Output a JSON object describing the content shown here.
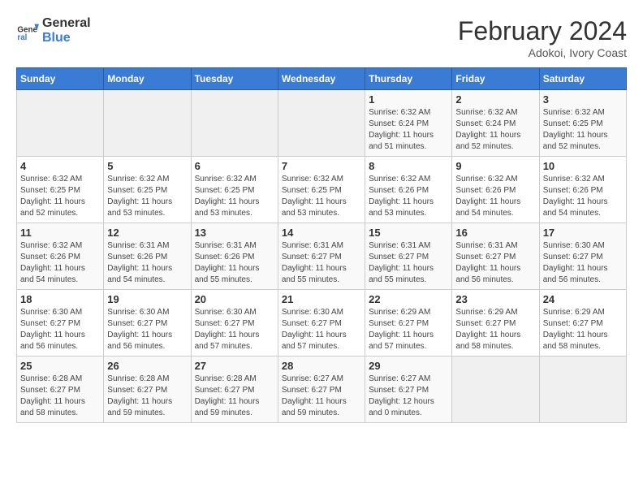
{
  "header": {
    "logo_general": "General",
    "logo_blue": "Blue",
    "title": "February 2024",
    "subtitle": "Adokoi, Ivory Coast"
  },
  "days_of_week": [
    "Sunday",
    "Monday",
    "Tuesday",
    "Wednesday",
    "Thursday",
    "Friday",
    "Saturday"
  ],
  "weeks": [
    [
      {
        "day": "",
        "info": ""
      },
      {
        "day": "",
        "info": ""
      },
      {
        "day": "",
        "info": ""
      },
      {
        "day": "",
        "info": ""
      },
      {
        "day": "1",
        "info": "Sunrise: 6:32 AM\nSunset: 6:24 PM\nDaylight: 11 hours and 51 minutes."
      },
      {
        "day": "2",
        "info": "Sunrise: 6:32 AM\nSunset: 6:24 PM\nDaylight: 11 hours and 52 minutes."
      },
      {
        "day": "3",
        "info": "Sunrise: 6:32 AM\nSunset: 6:25 PM\nDaylight: 11 hours and 52 minutes."
      }
    ],
    [
      {
        "day": "4",
        "info": "Sunrise: 6:32 AM\nSunset: 6:25 PM\nDaylight: 11 hours and 52 minutes."
      },
      {
        "day": "5",
        "info": "Sunrise: 6:32 AM\nSunset: 6:25 PM\nDaylight: 11 hours and 53 minutes."
      },
      {
        "day": "6",
        "info": "Sunrise: 6:32 AM\nSunset: 6:25 PM\nDaylight: 11 hours and 53 minutes."
      },
      {
        "day": "7",
        "info": "Sunrise: 6:32 AM\nSunset: 6:25 PM\nDaylight: 11 hours and 53 minutes."
      },
      {
        "day": "8",
        "info": "Sunrise: 6:32 AM\nSunset: 6:26 PM\nDaylight: 11 hours and 53 minutes."
      },
      {
        "day": "9",
        "info": "Sunrise: 6:32 AM\nSunset: 6:26 PM\nDaylight: 11 hours and 54 minutes."
      },
      {
        "day": "10",
        "info": "Sunrise: 6:32 AM\nSunset: 6:26 PM\nDaylight: 11 hours and 54 minutes."
      }
    ],
    [
      {
        "day": "11",
        "info": "Sunrise: 6:32 AM\nSunset: 6:26 PM\nDaylight: 11 hours and 54 minutes."
      },
      {
        "day": "12",
        "info": "Sunrise: 6:31 AM\nSunset: 6:26 PM\nDaylight: 11 hours and 54 minutes."
      },
      {
        "day": "13",
        "info": "Sunrise: 6:31 AM\nSunset: 6:26 PM\nDaylight: 11 hours and 55 minutes."
      },
      {
        "day": "14",
        "info": "Sunrise: 6:31 AM\nSunset: 6:27 PM\nDaylight: 11 hours and 55 minutes."
      },
      {
        "day": "15",
        "info": "Sunrise: 6:31 AM\nSunset: 6:27 PM\nDaylight: 11 hours and 55 minutes."
      },
      {
        "day": "16",
        "info": "Sunrise: 6:31 AM\nSunset: 6:27 PM\nDaylight: 11 hours and 56 minutes."
      },
      {
        "day": "17",
        "info": "Sunrise: 6:30 AM\nSunset: 6:27 PM\nDaylight: 11 hours and 56 minutes."
      }
    ],
    [
      {
        "day": "18",
        "info": "Sunrise: 6:30 AM\nSunset: 6:27 PM\nDaylight: 11 hours and 56 minutes."
      },
      {
        "day": "19",
        "info": "Sunrise: 6:30 AM\nSunset: 6:27 PM\nDaylight: 11 hours and 56 minutes."
      },
      {
        "day": "20",
        "info": "Sunrise: 6:30 AM\nSunset: 6:27 PM\nDaylight: 11 hours and 57 minutes."
      },
      {
        "day": "21",
        "info": "Sunrise: 6:30 AM\nSunset: 6:27 PM\nDaylight: 11 hours and 57 minutes."
      },
      {
        "day": "22",
        "info": "Sunrise: 6:29 AM\nSunset: 6:27 PM\nDaylight: 11 hours and 57 minutes."
      },
      {
        "day": "23",
        "info": "Sunrise: 6:29 AM\nSunset: 6:27 PM\nDaylight: 11 hours and 58 minutes."
      },
      {
        "day": "24",
        "info": "Sunrise: 6:29 AM\nSunset: 6:27 PM\nDaylight: 11 hours and 58 minutes."
      }
    ],
    [
      {
        "day": "25",
        "info": "Sunrise: 6:28 AM\nSunset: 6:27 PM\nDaylight: 11 hours and 58 minutes."
      },
      {
        "day": "26",
        "info": "Sunrise: 6:28 AM\nSunset: 6:27 PM\nDaylight: 11 hours and 59 minutes."
      },
      {
        "day": "27",
        "info": "Sunrise: 6:28 AM\nSunset: 6:27 PM\nDaylight: 11 hours and 59 minutes."
      },
      {
        "day": "28",
        "info": "Sunrise: 6:27 AM\nSunset: 6:27 PM\nDaylight: 11 hours and 59 minutes."
      },
      {
        "day": "29",
        "info": "Sunrise: 6:27 AM\nSunset: 6:27 PM\nDaylight: 12 hours and 0 minutes."
      },
      {
        "day": "",
        "info": ""
      },
      {
        "day": "",
        "info": ""
      }
    ]
  ]
}
